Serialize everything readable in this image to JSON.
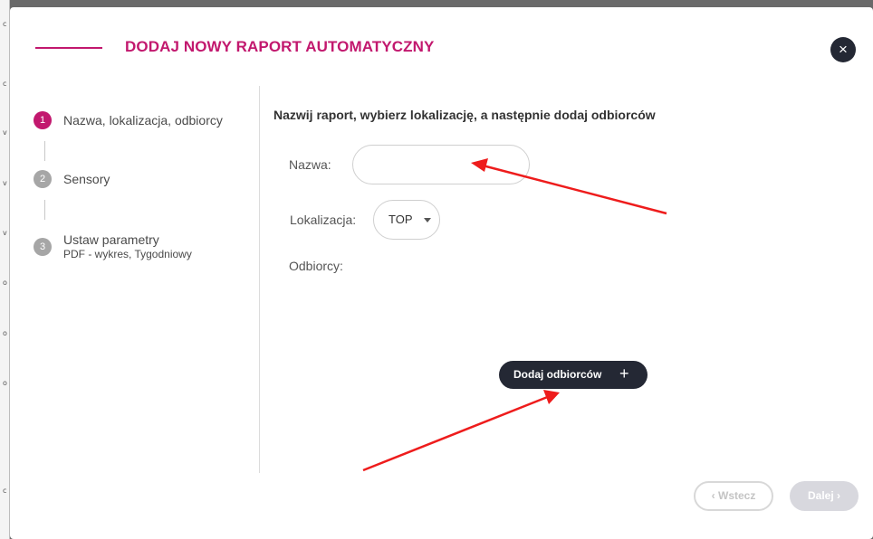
{
  "background": {
    "edge_glyphs": [
      "c",
      "c",
      "v",
      "v",
      "v",
      "o",
      "o",
      "o",
      "c"
    ]
  },
  "modal": {
    "title": "DODAJ NOWY RAPORT AUTOMATYCZNY",
    "close_icon": "×"
  },
  "steps": [
    {
      "number": "1",
      "label": "Nazwa, lokalizacja, odbiorcy",
      "sub": "",
      "state": "active"
    },
    {
      "number": "2",
      "label": "Sensory",
      "sub": "",
      "state": "inactive"
    },
    {
      "number": "3",
      "label": "Ustaw parametry",
      "sub": "PDF - wykres, Tygodniowy",
      "state": "inactive"
    }
  ],
  "form": {
    "heading": "Nazwij raport, wybierz lokalizację, a następnie dodaj odbiorców",
    "name_label": "Nazwa:",
    "name_value": "",
    "location_label": "Lokalizacja:",
    "location_value": "TOP",
    "recipients_label": "Odbiorcy:",
    "add_recipients_label": "Dodaj odbiorców",
    "add_icon": "+"
  },
  "footer": {
    "back_label": "‹ Wstecz",
    "next_label": "Dalej ›"
  },
  "colors": {
    "accent": "#c2186e",
    "dark_button": "#242834",
    "annotation_arrow": "#ee1c1c"
  }
}
